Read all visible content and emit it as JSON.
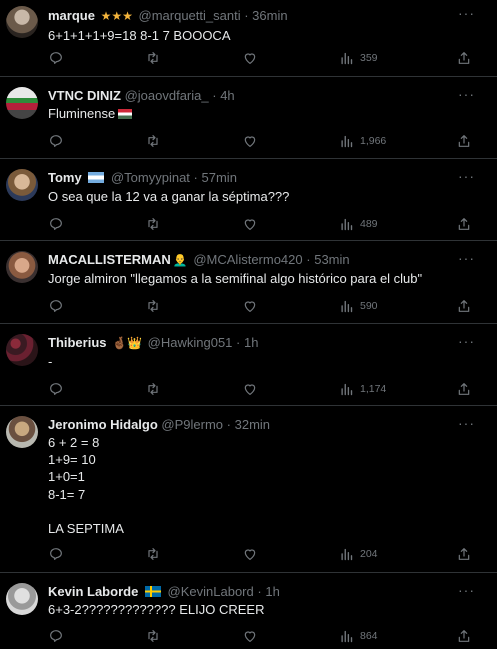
{
  "tweets": [
    {
      "name": "marque",
      "badges": "★★★",
      "handle": "@marquetti_santi",
      "time": "36min",
      "text": "6+1+1+1+9=18 8-1 7 BOOOCA",
      "views": "359"
    },
    {
      "name": "VTNC DINIZ",
      "handle": "@joaovdfaria_",
      "time": "4h",
      "text": "Fluminense",
      "views": "1,966"
    },
    {
      "name": "Tomy",
      "handle": "@Tomyypinat",
      "time": "57min",
      "text": "O sea que la 12 va a ganar la séptima???",
      "views": "489"
    },
    {
      "name": "MACALLISTERMAN",
      "badges": "👨‍🦲",
      "handle": "@MCAlistermo420",
      "time": "53min",
      "text": "Jorge almiron \"llegamos a la semifinal algo histórico para el club\"",
      "views": "590"
    },
    {
      "name": "Thiberius",
      "badges": "🤞🏾👑",
      "handle": "@Hawking051",
      "time": "1h",
      "text": "-",
      "views": "1,174"
    },
    {
      "name": "Jeronimo Hidalgo",
      "handle": "@P9lermo",
      "time": "32min",
      "text": "6 + 2 = 8\n1+9= 10\n1+0=1\n8-1= 7\n\nLA SEPTIMA",
      "views": "204"
    },
    {
      "name": "Kevin Laborde",
      "handle": "@KevinLabord",
      "time": "1h",
      "text": "6+3-2????????????? ELIJO CREER",
      "views": "864"
    }
  ],
  "separator": "·",
  "more_glyph": "···",
  "icons": [
    "reply-icon",
    "retweet-icon",
    "like-icon",
    "views-icon",
    "share-icon",
    "more-icon"
  ],
  "colors": {
    "background": "#000000",
    "text": "#e7e9ea",
    "muted": "#71767b",
    "border": "#2f3336"
  }
}
